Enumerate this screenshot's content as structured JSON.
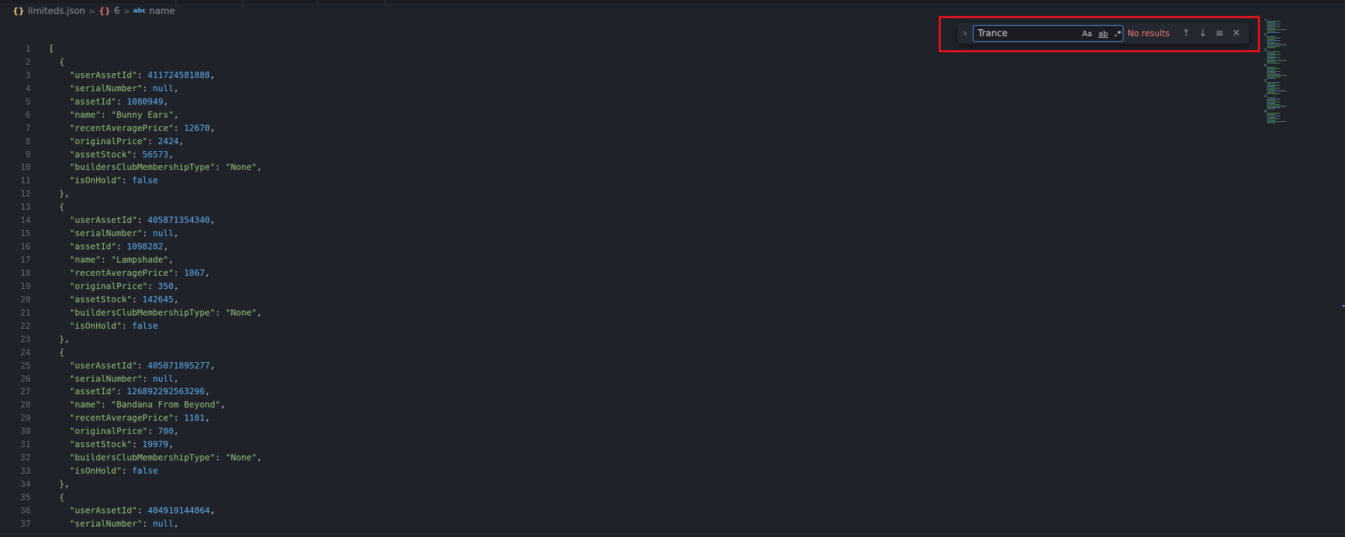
{
  "breadcrumb": {
    "file": "limiteds.json",
    "array_index": "6",
    "property": "name",
    "json_glyph": "{}",
    "object_glyph": "{}",
    "string_glyph": "abc"
  },
  "find": {
    "query": "Trance",
    "case_label": "Aa",
    "word_label": "ab",
    "regex_label": ".*",
    "status": "No results",
    "toggle_glyph": "›",
    "prev_glyph": "↑",
    "next_glyph": "↓",
    "selection_glyph": "≡",
    "close_glyph": "✕"
  },
  "colors": {
    "highlight_border": "#e3121d",
    "input_border": "#4d8ef0",
    "key": "#98c379",
    "number": "#61afef",
    "status_error": "#f27872"
  },
  "records": [
    {
      "userAssetId": "411724581888",
      "assetId": "1080949",
      "name": "Bunny Ears",
      "recentAveragePrice": "12670",
      "originalPrice": "2424",
      "assetStock": "56573"
    },
    {
      "userAssetId": "405871354340",
      "assetId": "1098282",
      "name": "Lampshade",
      "recentAveragePrice": "1867",
      "originalPrice": "350",
      "assetStock": "142645"
    },
    {
      "userAssetId": "405071895277",
      "assetId": "126892292563296",
      "name": "Bandana From Beyond",
      "recentAveragePrice": "1181",
      "originalPrice": "700",
      "assetStock": "19979"
    },
    {
      "userAssetId": "404919144864"
    }
  ],
  "literals": {
    "null": "null",
    "false": "false",
    "buildersClubMembershipType": "None"
  }
}
